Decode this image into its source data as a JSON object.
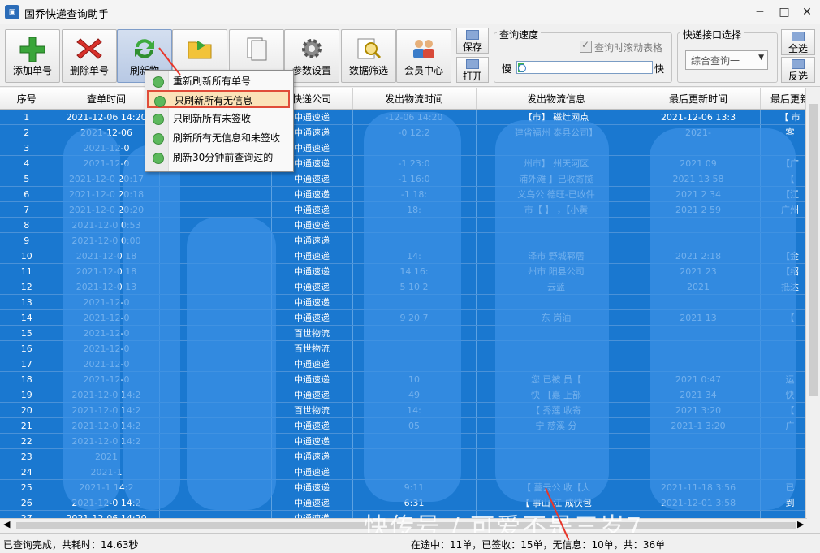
{
  "window": {
    "title": "固乔快递查询助手",
    "minimize": "─",
    "maximize": "□",
    "close": "✕"
  },
  "toolbar": {
    "add": "添加单号",
    "delete": "删除单号",
    "refresh": "刷新物",
    "settings": "参数设置",
    "filter": "数据筛选",
    "member": "会员中心",
    "save": "保存",
    "open": "打开",
    "speed_group": "查询速度",
    "scroll_checkbox": "查询时滚动表格",
    "slow": "慢",
    "fast": "快",
    "speed_level": 0.05,
    "courier_group": "快递接口选择",
    "courier_select": "综合查询一",
    "select_all": "全选",
    "invert": "反选"
  },
  "columns": [
    "序号",
    "查单时间",
    "",
    "快递公司",
    "发出物流时间",
    "发出物流信息",
    "最后更新时间",
    "最后更新"
  ],
  "rows": [
    [
      "1",
      "2021-12-06 14:20",
      "",
      "中通速递",
      "-12-06 14:20",
      "【市】 磁灶网点",
      "2021-12-06 13:3",
      "【 市"
    ],
    [
      "2",
      "2021-12-06",
      "",
      "中通速递",
      "-0 12:2",
      "建省福州 泰县公司】",
      "2021-",
      "客"
    ],
    [
      "3",
      "2021-12-0",
      "",
      "中通速递",
      "",
      "",
      "",
      ""
    ],
    [
      "4",
      "2021-12-0",
      "",
      "中通速递",
      "-1 23:0",
      "州市】 州天河区 ",
      "2021 09",
      "【广"
    ],
    [
      "5",
      "2021-12-0 20:17",
      "",
      "中通速递",
      "-1 16:0",
      "浦外滩 】已收寄揽",
      "2021 13 58",
      "【"
    ],
    [
      "6",
      "2021-12-0 20:18",
      "",
      "中通速递",
      "-1 18:",
      "义乌公 德旺-已收件",
      "2021 2 34",
      "【江"
    ],
    [
      "7",
      "2021-12-0 20:20",
      "",
      "中通速递",
      "18:",
      "市【 】 ，【小黄",
      "2021 2 59",
      "广州"
    ],
    [
      "8",
      "2021-12-0 0:53",
      "",
      "中通速递",
      "",
      "",
      "",
      ""
    ],
    [
      "9",
      "2021-12-0 0:00",
      "",
      "中通速递",
      "",
      "",
      "",
      ""
    ],
    [
      "10",
      "2021-12-0 18",
      "",
      "中通速递",
      "14:",
      "泽市 野城郓居",
      "2021 2:18",
      "【金"
    ],
    [
      "11",
      "2021-12-0 18",
      "",
      "中通速递",
      "14 16:",
      "州市 阳县公司",
      "2021 23",
      "【绍"
    ],
    [
      "12",
      "2021-12-0 13",
      "",
      "中通速递",
      "5 10 2",
      "云蓝",
      "2021",
      "抵达"
    ],
    [
      "13",
      "2021-12-0",
      "",
      "中通速递",
      "",
      "",
      "",
      ""
    ],
    [
      "14",
      "2021-12-0",
      "",
      "中通速递",
      "9 20 7",
      "东 岗油 ",
      "2021 13",
      "【"
    ],
    [
      "15",
      "2021-12-0",
      "",
      "百世物流",
      "",
      "",
      "",
      ""
    ],
    [
      "16",
      "2021-12-0",
      "",
      "百世物流",
      "",
      "",
      "",
      ""
    ],
    [
      "17",
      "2021-12-0",
      "",
      "中通速递",
      "",
      "",
      "",
      ""
    ],
    [
      "18",
      "2021-12-0",
      "",
      "中通速递",
      "10",
      "您 已被 员【",
      "2021 0:47",
      "运"
    ],
    [
      "19",
      "2021-12-0 14:2",
      "",
      "中通速递",
      "49",
      "快 【嘉 上部",
      "2021 34",
      "快"
    ],
    [
      "20",
      "2021-12-0 14:2",
      "",
      "百世物流",
      "14:",
      "【 秀莲 收寄",
      "2021 3:20",
      "【"
    ],
    [
      "21",
      "2021-12-0 14:2",
      "",
      "中通速递",
      "05",
      "宁 慈溪 分",
      "2021-1 3:20",
      "广"
    ],
    [
      "22",
      "2021-12-0 14:2",
      "",
      "中通速递",
      "",
      "",
      "",
      ""
    ],
    [
      "23",
      "2021",
      "",
      "中通速递",
      "",
      "",
      "",
      ""
    ],
    [
      "24",
      "2021-1",
      "",
      "中通速递",
      "",
      "",
      "",
      ""
    ],
    [
      "25",
      "2021-1 14:2",
      "",
      "中通速递",
      "9:11",
      "【 蔓云公 收【大",
      "2021-11-18 3:56",
      "已"
    ],
    [
      "26",
      "2021-12-0 14:2",
      "",
      "中通速递",
      "6:31",
      "【 事山 江 成快包",
      "2021-12-01 3:58",
      "到"
    ],
    [
      "27",
      "2021-12-06 14:20",
      "",
      "中通速递",
      "",
      "",
      "",
      ""
    ]
  ],
  "context_menu": [
    "重新刷新所有单号",
    "只刷新所有无信息",
    "只刷新所有未签收",
    "刷新所有无信息和未签收",
    "刷新30分钟前查询过的"
  ],
  "status": {
    "left": "已查询完成，共耗时：14.63秒",
    "right": "在途中：11单，已签收：15单，无信息：10单，共：36单"
  },
  "watermark": "快传号 / 可爱不是三岁7"
}
